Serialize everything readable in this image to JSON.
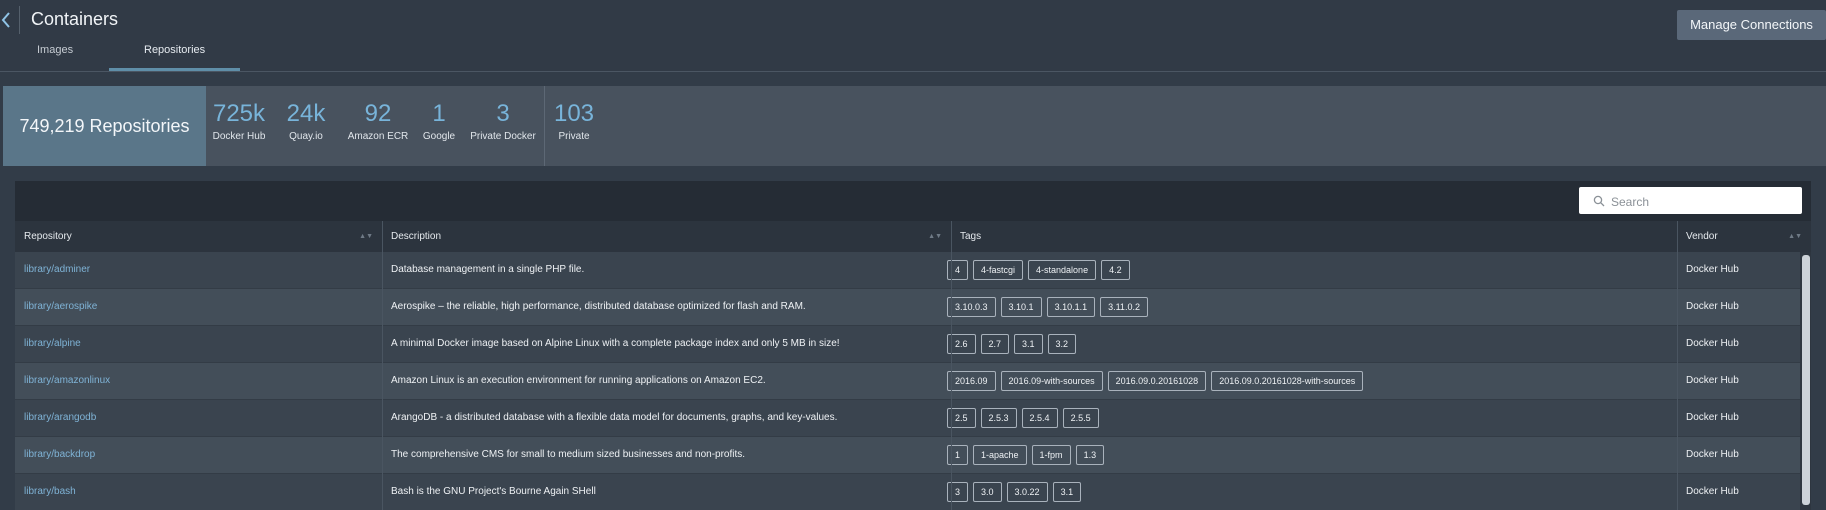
{
  "header": {
    "title": "Containers",
    "tabs": [
      {
        "label": "Images"
      },
      {
        "label": "Repositories"
      }
    ],
    "active_tab": "Repositories",
    "manage_button_label": "Manage Connections"
  },
  "stats": {
    "total_label": "749,219 Repositories",
    "items": [
      {
        "value": "725k",
        "label": "Docker Hub"
      },
      {
        "value": "24k",
        "label": "Quay.io"
      },
      {
        "value": "92",
        "label": "Amazon ECR"
      },
      {
        "value": "1",
        "label": "Google"
      },
      {
        "value": "3",
        "label": "Private Docker"
      },
      {
        "value": "103",
        "label": "Private"
      }
    ]
  },
  "search": {
    "placeholder": "Search",
    "value": ""
  },
  "table": {
    "columns": [
      "Repository",
      "Description",
      "Tags",
      "Vendor"
    ],
    "rows": [
      {
        "repository": "library/adminer",
        "description": "Database management in a single PHP file.",
        "tags": [
          "4",
          "4-fastcgi",
          "4-standalone",
          "4.2"
        ],
        "vendor": "Docker Hub"
      },
      {
        "repository": "library/aerospike",
        "description": "Aerospike – the reliable, high performance, distributed database optimized for flash and RAM.",
        "tags": [
          "3.10.0.3",
          "3.10.1",
          "3.10.1.1",
          "3.11.0.2"
        ],
        "vendor": "Docker Hub"
      },
      {
        "repository": "library/alpine",
        "description": "A minimal Docker image based on Alpine Linux with a complete package index and only 5 MB in size!",
        "tags": [
          "2.6",
          "2.7",
          "3.1",
          "3.2"
        ],
        "vendor": "Docker Hub"
      },
      {
        "repository": "library/amazonlinux",
        "description": "Amazon Linux is an execution environment for running applications on Amazon EC2.",
        "tags": [
          "2016.09",
          "2016.09-with-sources",
          "2016.09.0.20161028",
          "2016.09.0.20161028-with-sources"
        ],
        "vendor": "Docker Hub"
      },
      {
        "repository": "library/arangodb",
        "description": "ArangoDB - a distributed database with a flexible data model for documents, graphs, and key-values.",
        "tags": [
          "2.5",
          "2.5.3",
          "2.5.4",
          "2.5.5"
        ],
        "vendor": "Docker Hub"
      },
      {
        "repository": "library/backdrop",
        "description": "The comprehensive CMS for small to medium sized businesses and non-profits.",
        "tags": [
          "1",
          "1-apache",
          "1-fpm",
          "1.3"
        ],
        "vendor": "Docker Hub"
      },
      {
        "repository": "library/bash",
        "description": "Bash is the GNU Project's Bourne Again SHell",
        "tags": [
          "3",
          "3.0",
          "3.0.22",
          "3.1"
        ],
        "vendor": "Docker Hub"
      }
    ]
  },
  "colors": {
    "background": "#323c48",
    "accent_blue": "#78b4da",
    "link_blue": "#7fb3d6",
    "total_tile": "#5a7689",
    "button": "#5a6879"
  },
  "icons": {
    "back": "chevron-left-icon",
    "search": "search-icon",
    "sort": "sort-icon"
  }
}
